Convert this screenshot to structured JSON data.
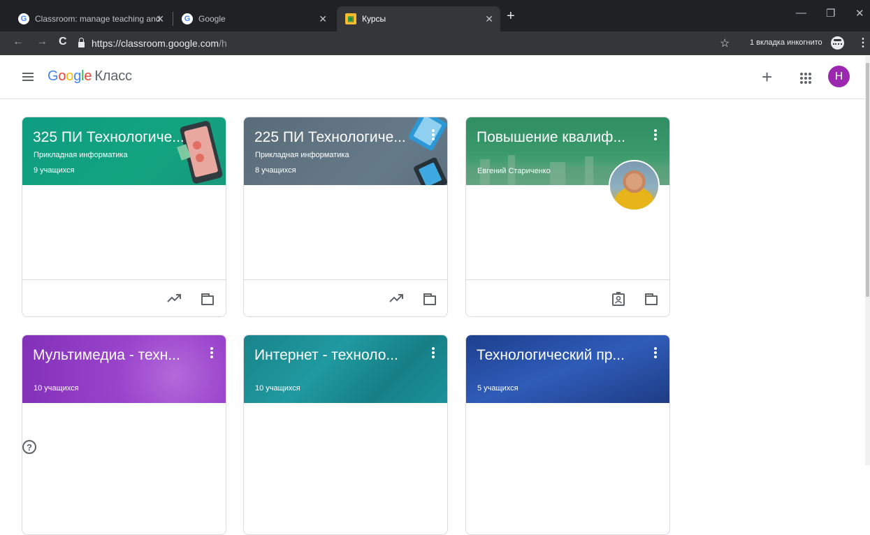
{
  "browser": {
    "tabs": [
      {
        "title": "Classroom: manage teaching and",
        "active": false
      },
      {
        "title": "Google",
        "active": false
      },
      {
        "title": "Курсы",
        "active": true
      }
    ],
    "url_host": "https://classroom.google.com",
    "url_path": "/h",
    "incognito_label": "1 вкладка инкогнито"
  },
  "app": {
    "logo_google": "Google",
    "logo_product": "Класс",
    "avatar_letter": "Н",
    "help_glyph": "?"
  },
  "colors": {
    "chrome_dark": "#202124",
    "avatar": "#9c27b0",
    "card_teal": "#12a37f",
    "card_slate": "#607382",
    "card_green": "#2e8b57",
    "card_purple": "#8e32c4",
    "card_cyan": "#1b8f96",
    "card_blue": "#274a9e"
  },
  "courses": [
    {
      "title": "325 ПИ Технологиче...",
      "subtitle": "Прикладная информатика",
      "count": "9 учащихся",
      "footer_icons": [
        "trending-up-icon",
        "folder-icon"
      ]
    },
    {
      "title": "225 ПИ Технологиче...",
      "subtitle": "Прикладная информатика",
      "count": "8 учащихся",
      "footer_icons": [
        "trending-up-icon",
        "folder-icon"
      ]
    },
    {
      "title": "Повышение квалиф...",
      "subtitle": "Евгений Стариченко",
      "count": "",
      "footer_icons": [
        "portfolio-icon",
        "folder-icon"
      ]
    },
    {
      "title": "Мультимедиа - техн...",
      "subtitle": "",
      "count": "10 учащихся"
    },
    {
      "title": "Интернет - техноло...",
      "subtitle": "",
      "count": "10 учащихся"
    },
    {
      "title": "Технологический пр...",
      "subtitle": "",
      "count": "5 учащихся"
    }
  ]
}
